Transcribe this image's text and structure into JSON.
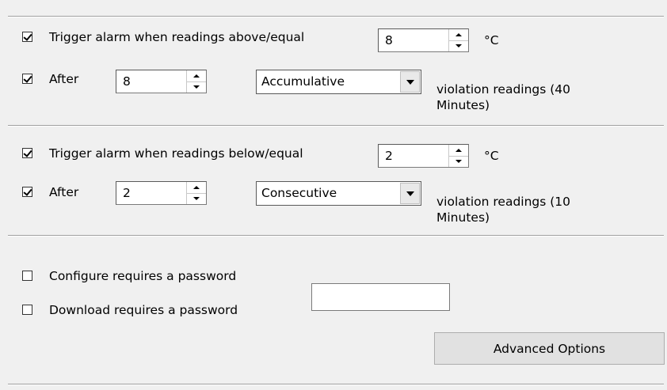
{
  "high_alarm": {
    "checked": true,
    "label": "Trigger alarm when readings above/equal",
    "threshold": "8",
    "unit": "°C",
    "after_checked": true,
    "after_label": "After",
    "after_count": "8",
    "mode": "Accumulative",
    "violation_text_line1": "violation readings (40",
    "violation_text_line2": "Minutes)"
  },
  "low_alarm": {
    "checked": true,
    "label": "Trigger alarm when readings below/equal",
    "threshold": "2",
    "unit": "°C",
    "after_checked": true,
    "after_label": "After",
    "after_count": "2",
    "mode": "Consecutive",
    "violation_text_line1": "violation readings (10",
    "violation_text_line2": "Minutes)"
  },
  "password": {
    "configure_checked": false,
    "configure_label": "Configure requires a password",
    "download_checked": false,
    "download_label": "Download requires a password",
    "value": ""
  },
  "advanced_button_label": "Advanced Options"
}
